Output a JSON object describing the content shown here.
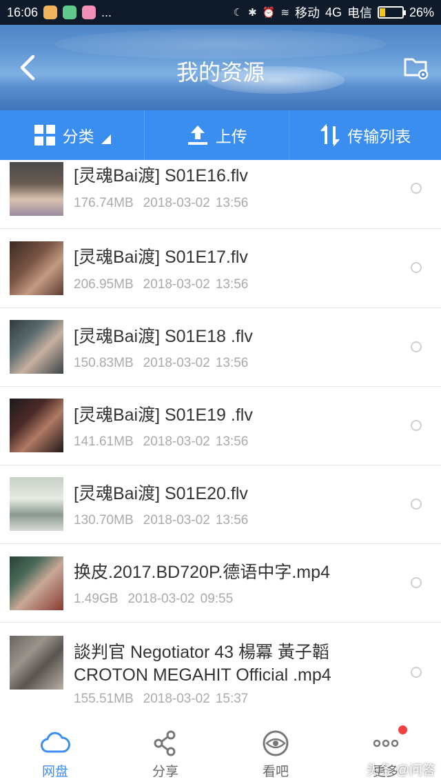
{
  "status_bar": {
    "time": "16:06",
    "dots": "...",
    "carrier1": "移动",
    "network": "4G",
    "carrier2": "电信",
    "battery": "26%",
    "battery_level": 0.26
  },
  "header": {
    "title": "我的资源",
    "back_icon": "chevron-left-icon",
    "folder_icon": "folder-settings-icon"
  },
  "toolbar": {
    "category_label": "分类",
    "upload_label": "上传",
    "transfer_label": "传输列表"
  },
  "files": [
    {
      "name": "[灵魂Bai渡] S01E16.flv",
      "size": "176.74MB",
      "date": "2018-03-02",
      "time": "13:56"
    },
    {
      "name": "[灵魂Bai渡] S01E17.flv",
      "size": "206.95MB",
      "date": "2018-03-02",
      "time": "13:56"
    },
    {
      "name": "[灵魂Bai渡] S01E18 .flv",
      "size": "150.83MB",
      "date": "2018-03-02",
      "time": "13:56"
    },
    {
      "name": "[灵魂Bai渡] S01E19 .flv",
      "size": "141.61MB",
      "date": "2018-03-02",
      "time": "13:56"
    },
    {
      "name": "[灵魂Bai渡] S01E20.flv",
      "size": "130.70MB",
      "date": "2018-03-02",
      "time": "13:56"
    },
    {
      "name": "换皮.2017.BD720P.德语中字.mp4",
      "size": "1.49GB",
      "date": "2018-03-02",
      "time": "09:55"
    },
    {
      "name_line1": "談判官 Negotiator 43 楊冪 黃子韜",
      "name_line2": "CROTON MEGAHIT Official .mp4",
      "size": "155.51MB",
      "date": "2018-03-02",
      "time": "15:37"
    }
  ],
  "bottom_nav": {
    "items": [
      {
        "label": "网盘",
        "icon": "cloud-icon",
        "active": true
      },
      {
        "label": "分享",
        "icon": "share-icon",
        "active": false
      },
      {
        "label": "看吧",
        "icon": "eye-icon",
        "active": false
      },
      {
        "label": "更多",
        "icon": "more-dots-icon",
        "active": false
      }
    ],
    "watermark": "头条 @问答"
  },
  "colors": {
    "accent": "#3a8ef0",
    "status_bar": "#0f1a2a",
    "badge": "#f04040"
  }
}
